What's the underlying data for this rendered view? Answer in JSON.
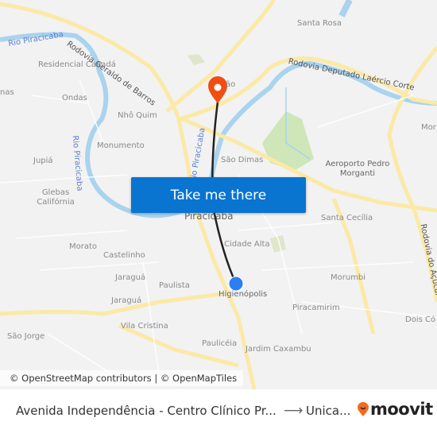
{
  "map": {
    "labels": [
      "Santa Rosa",
      "Residencial Canadá",
      "Ondas",
      "Nhô Quim",
      "Monumento",
      "Jupiá",
      "Glebas Califórnia",
      "São Dimas",
      "Aeroporto Pedro Morganti",
      "Piracicaba",
      "Santa Cecília",
      "Cidade Alta",
      "Morato",
      "Castelinho",
      "Jaraguá",
      "Paulista",
      "Jaraguá",
      "Higienópolis",
      "Piracamirim",
      "Morumbi",
      "Vila Cristina",
      "São Jorge",
      "Paulicéia",
      "Jardim Caxambu",
      "Dois Có",
      "Mor",
      "nas",
      "ão"
    ],
    "rivers": [
      "Rio Piracicaba",
      "Rio Piracicaba",
      "Rio Piracicaba"
    ],
    "roads": [
      "Rodovia Geraldo de Barros",
      "Rodovia Deputado Laércio Corte",
      "Rodovia do Açúcar"
    ],
    "colors": {
      "origin": "#2b7ff0",
      "destination": "#f04e12",
      "route": "#222222",
      "button": "#0a74d1",
      "water": "#a9d3ee",
      "highway": "#fbe9a6",
      "park": "#cfe6b8"
    }
  },
  "cta": {
    "label": "Take me there"
  },
  "attribution": "© OpenStreetMap contributors | © OpenMapTiles",
  "footer": {
    "origin": "Avenida Independência - Centro Clínico Pr...",
    "arrow_icon": "arrow-right-icon",
    "destination": "Unica...",
    "brand": "moovit"
  }
}
